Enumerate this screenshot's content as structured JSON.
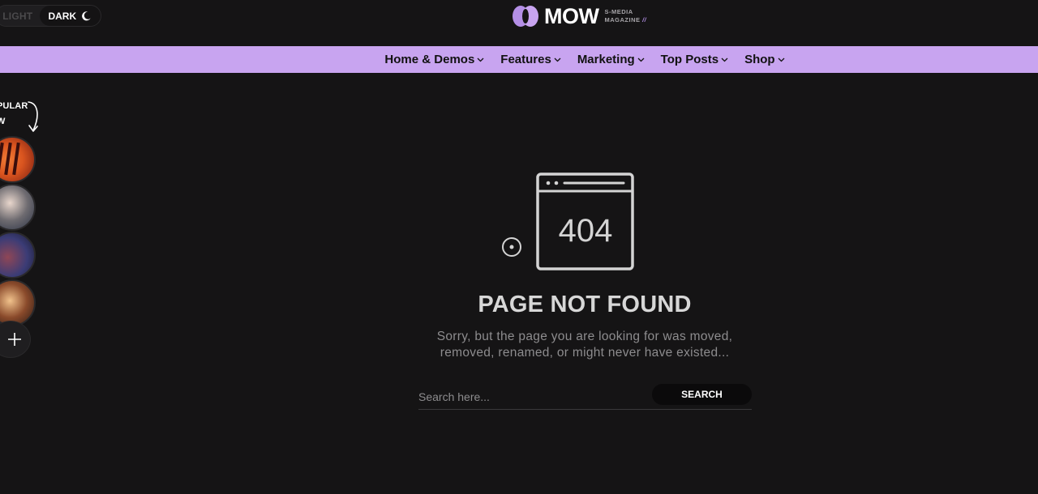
{
  "theme": {
    "background": "#151415",
    "accent": "#c8a4f0",
    "text": "#e6e6e6",
    "muted": "#8d8c8e"
  },
  "header": {
    "mode_toggle": {
      "light_label": "LIGHT",
      "dark_label": "DARK",
      "active": "dark"
    },
    "logo": {
      "name": "MOW",
      "sub_line1": "S-MEDIA",
      "sub_line2": "MAGAZINE",
      "slash": "//"
    }
  },
  "nav": {
    "items": [
      {
        "label": "Home & Demos",
        "icon": "chevron-down-icon"
      },
      {
        "label": "Features",
        "icon": "chevron-down-icon"
      },
      {
        "label": "Marketing",
        "icon": "chevron-down-icon"
      },
      {
        "label": "Top Posts",
        "icon": "chevron-down-icon"
      },
      {
        "label": "Shop",
        "icon": "chevron-down-icon"
      }
    ]
  },
  "popular": {
    "label": "PULAR\nW",
    "items": [
      "popular-story-1",
      "popular-story-2",
      "popular-story-3",
      "popular-story-4"
    ],
    "more_icon": "plus-icon"
  },
  "error_page": {
    "code": "404",
    "title": "PAGE NOT FOUND",
    "message": "Sorry, but the page you are looking for was moved, removed, renamed, or might never have existed...",
    "search": {
      "placeholder": "Search here...",
      "value": "",
      "button_label": "SEARCH"
    }
  }
}
